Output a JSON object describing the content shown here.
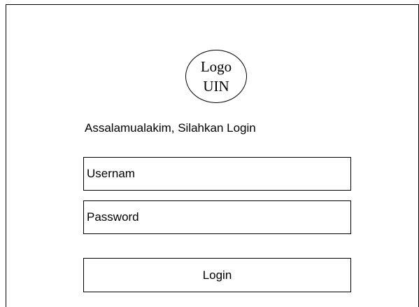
{
  "logo": {
    "line1": "Logo",
    "line2": "UIN"
  },
  "greeting": "Assalamualakim, Silahkan Login",
  "form": {
    "username_placeholder": "Usernam",
    "password_placeholder": "Password",
    "login_label": "Login"
  }
}
